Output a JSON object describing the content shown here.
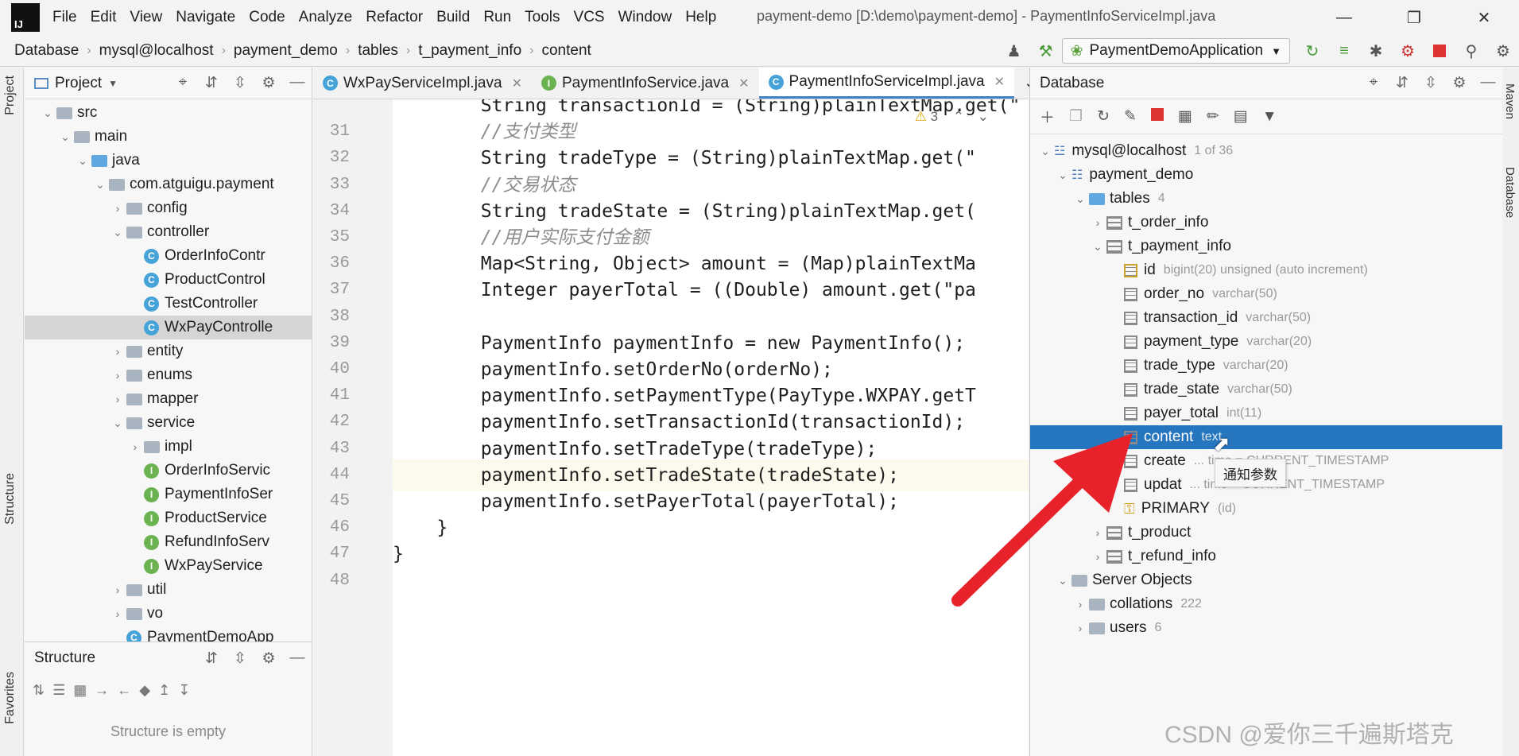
{
  "app": {
    "logo": "IJ",
    "window_title": "payment-demo [D:\\demo\\payment-demo] - PaymentInfoServiceImpl.java"
  },
  "menu": [
    "File",
    "Edit",
    "View",
    "Navigate",
    "Code",
    "Analyze",
    "Refactor",
    "Build",
    "Run",
    "Tools",
    "VCS",
    "Window",
    "Help"
  ],
  "breadcrumb": [
    "Database",
    "mysql@localhost",
    "payment_demo",
    "tables",
    "t_payment_info",
    "content"
  ],
  "run_config": "PaymentDemoApplication",
  "project": {
    "title": "Project",
    "tree": [
      {
        "label": "src",
        "indent": 1,
        "arrow": "v",
        "icon": "folder"
      },
      {
        "label": "main",
        "indent": 2,
        "arrow": "v",
        "icon": "folder"
      },
      {
        "label": "java",
        "indent": 3,
        "arrow": "v",
        "icon": "folder-blue"
      },
      {
        "label": "com.atguigu.payment",
        "indent": 4,
        "arrow": "v",
        "icon": "folder"
      },
      {
        "label": "config",
        "indent": 5,
        "arrow": ">",
        "icon": "folder"
      },
      {
        "label": "controller",
        "indent": 5,
        "arrow": "v",
        "icon": "folder"
      },
      {
        "label": "OrderInfoContr",
        "indent": 6,
        "arrow": "",
        "icon": "class"
      },
      {
        "label": "ProductControl",
        "indent": 6,
        "arrow": "",
        "icon": "class"
      },
      {
        "label": "TestController",
        "indent": 6,
        "arrow": "",
        "icon": "class"
      },
      {
        "label": "WxPayControlle",
        "indent": 6,
        "arrow": "",
        "icon": "class",
        "selected": true
      },
      {
        "label": "entity",
        "indent": 5,
        "arrow": ">",
        "icon": "folder"
      },
      {
        "label": "enums",
        "indent": 5,
        "arrow": ">",
        "icon": "folder"
      },
      {
        "label": "mapper",
        "indent": 5,
        "arrow": ">",
        "icon": "folder"
      },
      {
        "label": "service",
        "indent": 5,
        "arrow": "v",
        "icon": "folder"
      },
      {
        "label": "impl",
        "indent": 6,
        "arrow": ">",
        "icon": "folder"
      },
      {
        "label": "OrderInfoServic",
        "indent": 6,
        "arrow": "",
        "icon": "interface"
      },
      {
        "label": "PaymentInfoSer",
        "indent": 6,
        "arrow": "",
        "icon": "interface"
      },
      {
        "label": "ProductService",
        "indent": 6,
        "arrow": "",
        "icon": "interface"
      },
      {
        "label": "RefundInfoServ",
        "indent": 6,
        "arrow": "",
        "icon": "interface"
      },
      {
        "label": "WxPayService",
        "indent": 6,
        "arrow": "",
        "icon": "interface"
      },
      {
        "label": "util",
        "indent": 5,
        "arrow": ">",
        "icon": "folder"
      },
      {
        "label": "vo",
        "indent": 5,
        "arrow": ">",
        "icon": "folder"
      },
      {
        "label": "PaymentDemoApp",
        "indent": 5,
        "arrow": "",
        "icon": "app"
      }
    ]
  },
  "structure": {
    "title": "Structure",
    "empty_text": "Structure is empty"
  },
  "left_tabs": [
    "Project",
    "Structure",
    "Favorites"
  ],
  "right_tabs": [
    "Maven",
    "Database"
  ],
  "editor": {
    "tabs": [
      {
        "label": "WxPayServiceImpl.java",
        "icon": "class"
      },
      {
        "label": "PaymentInfoService.java",
        "icon": "interface"
      },
      {
        "label": "PaymentInfoServiceImpl.java",
        "icon": "class",
        "active": true
      }
    ],
    "warning_count": "3",
    "current_line": "44",
    "lines": [
      {
        "n": "",
        "text": "        String transactionId = (String)plainTextMap.get(\"",
        "type": "code"
      },
      {
        "n": "31",
        "text": "        //支付类型",
        "type": "comment"
      },
      {
        "n": "32",
        "text": "        String tradeType = (String)plainTextMap.get(\"",
        "type": "code"
      },
      {
        "n": "33",
        "text": "        //交易状态",
        "type": "comment"
      },
      {
        "n": "34",
        "text": "        String tradeState = (String)plainTextMap.get(",
        "type": "code"
      },
      {
        "n": "35",
        "text": "        //用户实际支付金额",
        "type": "comment"
      },
      {
        "n": "36",
        "text": "        Map<String, Object> amount = (Map)plainTextMa",
        "type": "code"
      },
      {
        "n": "37",
        "text": "        Integer payerTotal = ((Double) amount.get(\"pa",
        "type": "code"
      },
      {
        "n": "38",
        "text": "",
        "type": "code"
      },
      {
        "n": "39",
        "text": "        PaymentInfo paymentInfo = new PaymentInfo();",
        "type": "code"
      },
      {
        "n": "40",
        "text": "        paymentInfo.setOrderNo(orderNo);",
        "type": "code"
      },
      {
        "n": "41",
        "text": "        paymentInfo.setPaymentType(PayType.WXPAY.getT",
        "type": "code"
      },
      {
        "n": "42",
        "text": "        paymentInfo.setTransactionId(transactionId);",
        "type": "code"
      },
      {
        "n": "43",
        "text": "        paymentInfo.setTradeType(tradeType);",
        "type": "code"
      },
      {
        "n": "44",
        "text": "        paymentInfo.setTradeState(tradeState);",
        "type": "code"
      },
      {
        "n": "45",
        "text": "        paymentInfo.setPayerTotal(payerTotal);",
        "type": "code"
      },
      {
        "n": "46",
        "text": "    }",
        "type": "code"
      },
      {
        "n": "47",
        "text": "}",
        "type": "code"
      },
      {
        "n": "48",
        "text": "",
        "type": "code"
      }
    ]
  },
  "database": {
    "title": "Database",
    "tree": [
      {
        "label": "mysql@localhost",
        "meta": "1 of 36",
        "indent": 0,
        "arrow": "v",
        "icon": "datasource"
      },
      {
        "label": "payment_demo",
        "meta": "",
        "indent": 1,
        "arrow": "v",
        "icon": "schema"
      },
      {
        "label": "tables",
        "meta": "4",
        "indent": 2,
        "arrow": "v",
        "icon": "folder-blue"
      },
      {
        "label": "t_order_info",
        "meta": "",
        "indent": 3,
        "arrow": ">",
        "icon": "table"
      },
      {
        "label": "t_payment_info",
        "meta": "",
        "indent": 3,
        "arrow": "v",
        "icon": "table"
      },
      {
        "label": "id",
        "meta": "bigint(20) unsigned (auto increment)",
        "indent": 4,
        "arrow": "",
        "icon": "key-column"
      },
      {
        "label": "order_no",
        "meta": "varchar(50)",
        "indent": 4,
        "arrow": "",
        "icon": "column"
      },
      {
        "label": "transaction_id",
        "meta": "varchar(50)",
        "indent": 4,
        "arrow": "",
        "icon": "column"
      },
      {
        "label": "payment_type",
        "meta": "varchar(20)",
        "indent": 4,
        "arrow": "",
        "icon": "column"
      },
      {
        "label": "trade_type",
        "meta": "varchar(20)",
        "indent": 4,
        "arrow": "",
        "icon": "column"
      },
      {
        "label": "trade_state",
        "meta": "varchar(50)",
        "indent": 4,
        "arrow": "",
        "icon": "column"
      },
      {
        "label": "payer_total",
        "meta": "int(11)",
        "indent": 4,
        "arrow": "",
        "icon": "column"
      },
      {
        "label": "content",
        "meta": "text",
        "indent": 4,
        "arrow": "",
        "icon": "column",
        "selected": true
      },
      {
        "label": "create",
        "meta": "... time = CURRENT_TIMESTAMP",
        "indent": 4,
        "arrow": "",
        "icon": "column"
      },
      {
        "label": "updat",
        "meta": "... time = CURRENT_TIMESTAMP",
        "indent": 4,
        "arrow": "",
        "icon": "column"
      },
      {
        "label": "PRIMARY",
        "meta": "(id)",
        "indent": 4,
        "arrow": "",
        "icon": "key"
      },
      {
        "label": "t_product",
        "meta": "",
        "indent": 3,
        "arrow": ">",
        "icon": "table"
      },
      {
        "label": "t_refund_info",
        "meta": "",
        "indent": 3,
        "arrow": ">",
        "icon": "table"
      },
      {
        "label": "Server Objects",
        "meta": "",
        "indent": 1,
        "arrow": "v",
        "icon": "folder"
      },
      {
        "label": "collations",
        "meta": "222",
        "indent": 2,
        "arrow": ">",
        "icon": "folder"
      },
      {
        "label": "users",
        "meta": "6",
        "indent": 2,
        "arrow": ">",
        "icon": "folder"
      }
    ]
  },
  "tooltip": "通知参数",
  "watermark": "CSDN @爱你三千遍斯塔克",
  "colors": {
    "selection": "#2675bf",
    "accent_tab": "#4083c9",
    "arrow": "#e8222a"
  }
}
